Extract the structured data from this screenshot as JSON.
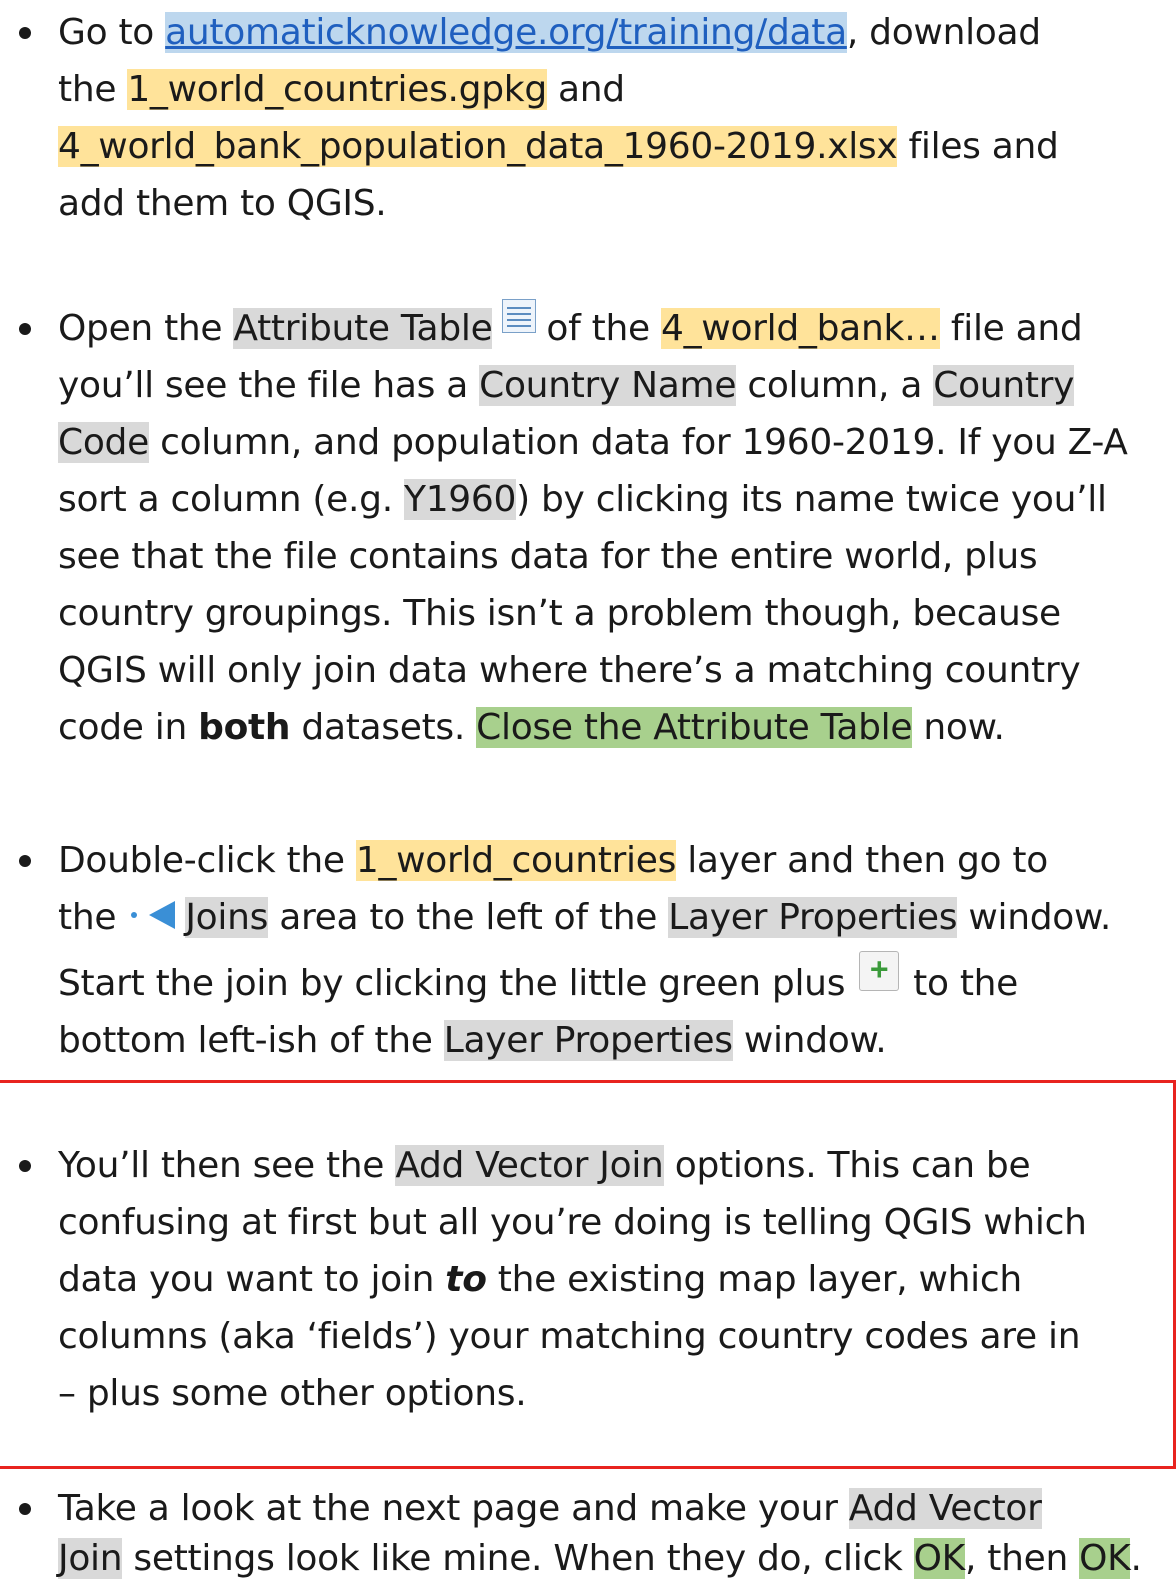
{
  "bullet1": {
    "l1": {
      "t1": "Go to ",
      "link": "automaticknowledge.org/training/data",
      "t2": ", download"
    },
    "l2": {
      "t1": "the ",
      "f1": "1_world_countries.gpkg",
      "t2": " and"
    },
    "l3": {
      "f2": "4_world_bank_population_data_1960-2019.xlsx",
      "t1": " files and"
    },
    "l4": {
      "t1": "add them to QGIS."
    }
  },
  "bullet2": {
    "l1": {
      "t1": "Open the ",
      "attr": "Attribute Table",
      "t2": "of the ",
      "file": "4_world_bank…",
      "t3": "  file and"
    },
    "l2": {
      "t1": "you’ll see the file has a ",
      "cn": "Country Name",
      "t2": " column, a ",
      "cc1": "Country"
    },
    "l3": {
      "cc2": "Code",
      "t1": " column, and population data for 1960-2019. If you Z-A"
    },
    "l4": {
      "t1": "sort a column (e.g. ",
      "y": "Y1960",
      "t2": ") by clicking its name twice you’ll"
    },
    "l5": {
      "t1": "see that the file contains data for the entire world, plus"
    },
    "l6": {
      "t1": "country groupings. This isn’t a problem though, because"
    },
    "l7": {
      "t1": "QGIS will only join data where there’s a matching country"
    },
    "l8": {
      "t1": "code in ",
      "b": "both",
      "t2": " datasets. ",
      "close": "Close the Attribute Table",
      "t3": " now."
    }
  },
  "bullet3": {
    "l1": {
      "t1": "Double-click the ",
      "layer": "1_world_countries",
      "t2": " layer and then go to"
    },
    "l2": {
      "t1": "the ",
      "joins": "Joins",
      "t2": " area to the left of the ",
      "lp": "Layer Properties",
      "t3": " window."
    },
    "l3": {
      "t1": "Start the join by clicking the little green plus",
      "t2": "to the"
    },
    "l4": {
      "t1": "bottom left-ish of the ",
      "lp": "Layer Properties",
      "t2": " window."
    }
  },
  "bullet4": {
    "l1": {
      "t1": "You’ll then see the ",
      "avj": "Add Vector Join",
      "t2": " options. This can be"
    },
    "l2": {
      "t1": "confusing at first but all you’re doing is telling QGIS which"
    },
    "l3": {
      "t1": "data you want to join ",
      "to": "to",
      "t2": " the existing map layer, which"
    },
    "l4": {
      "t1": "columns (aka ‘fields’) your matching country codes are in"
    },
    "l5": {
      "t1": "– plus some other options."
    }
  },
  "bullet5": {
    "l1": {
      "t1": "Take a look at the next page and make your ",
      "avj1": "Add Vector"
    },
    "l2": {
      "avj2": "Join",
      "t1": " settings look like mine. When they do, click ",
      "ok1": "OK",
      "t2": ", then ",
      "ok2": "OK",
      "t3": "."
    }
  }
}
